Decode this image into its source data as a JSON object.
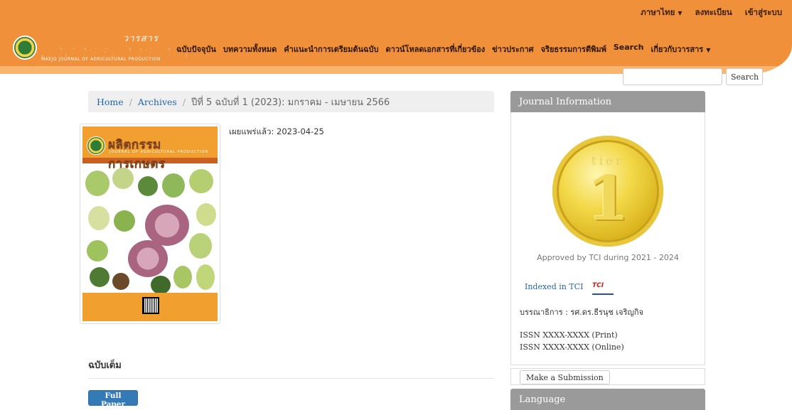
{
  "header": {
    "top_links": {
      "language": "ภาษาไทย",
      "register": "ลงทะเบียน",
      "login": "เข้าสู่ระบบ"
    },
    "logo": {
      "small": "วารสาร",
      "main": "ผลิตกรรมการเกษตร",
      "sub": "MAEJO JOURNAL OF AGRICULTURAL PRODUCTION"
    },
    "nav": [
      "ฉบับปัจจุบัน",
      "บทความทั้งหมด",
      "คำแนะนำการเตรียมต้นฉบับ",
      "ดาวน์โหลดเอกสารที่เกี่ยวข้อง",
      "ข่าวประกาศ",
      "จริยธรรมการตีพิมพ์",
      "Search",
      "เกี่ยวกับวารสาร"
    ]
  },
  "search": {
    "button_label": "Search",
    "value": ""
  },
  "breadcrumb": {
    "home": "Home",
    "archives": "Archives",
    "current": "ปีที่ 5 ฉบับที่ 1 (2023): มกราคม - เมษายน 2566"
  },
  "issue": {
    "published_label": "เผยแพร่แล้ว:",
    "published_date": "2023-04-25",
    "cover_title": "ผลิตกรรมการเกษตร",
    "cover_sub": "JOURNAL OF AGRICULTURAL PRODUCTION"
  },
  "full_issue": {
    "heading": "ฉบับเต็ม",
    "button_label": "Full Paper"
  },
  "sidebar": {
    "journal_info_title": "Journal Information",
    "badge_tier": "tier",
    "badge_number": "1",
    "badge_caption": "Approved by TCI during 2021 - 2024",
    "indexed_label": "Indexed in TCI",
    "tci_logo_text": "TCI",
    "editor": "บรรณาธิการ : รศ.ดร.ธีรนุช เจริญกิจ",
    "issn_print": "ISSN XXXX-XXXX (Print)",
    "issn_online": "ISSN XXXX-XXXX (Online)",
    "submission_label": "Make a Submission",
    "language_title": "Language"
  },
  "colors": {
    "header_orange": "#f0903a",
    "link_blue": "#2266aa",
    "button_blue": "#337ab7",
    "sidebar_header_gray": "#9a9a9a"
  }
}
